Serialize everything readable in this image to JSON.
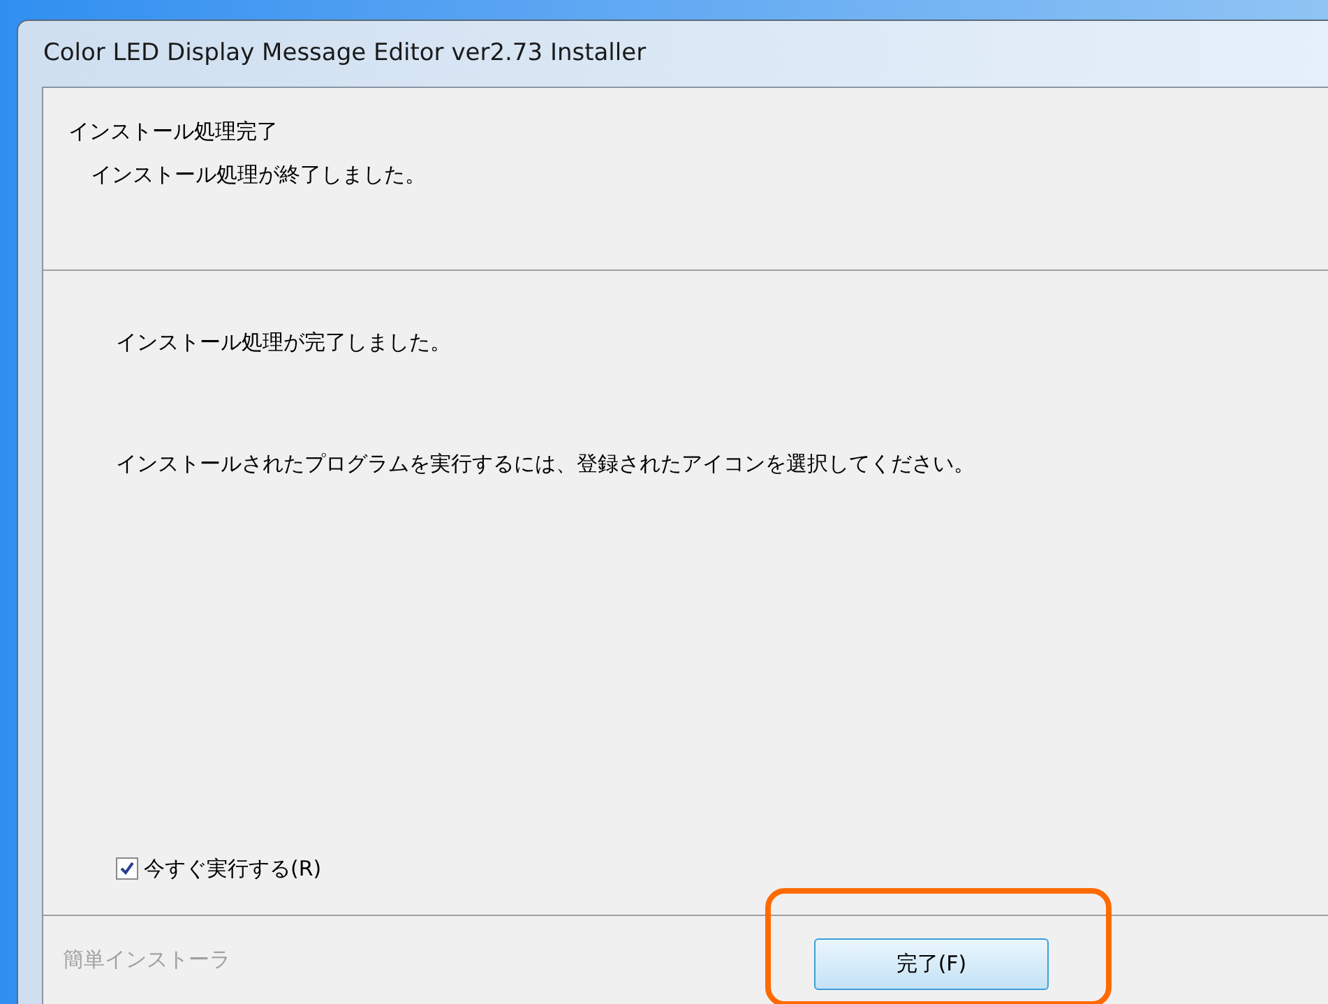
{
  "window": {
    "title": "Color LED Display Message Editor ver2.73 Installer"
  },
  "header": {
    "title": "インストール処理完了",
    "subtitle": "インストール処理が終了しました。"
  },
  "body": {
    "messages": [
      "インストール処理が完了しました。",
      "インストールされたプログラムを実行するには、登録されたアイコンを選択してください。"
    ],
    "run_now": {
      "label": "今すぐ実行する(R)",
      "checked": true
    }
  },
  "footer": {
    "brand": "簡単インストーラ",
    "finish_button": {
      "label": "完了(F)",
      "highlighted": true
    }
  }
}
